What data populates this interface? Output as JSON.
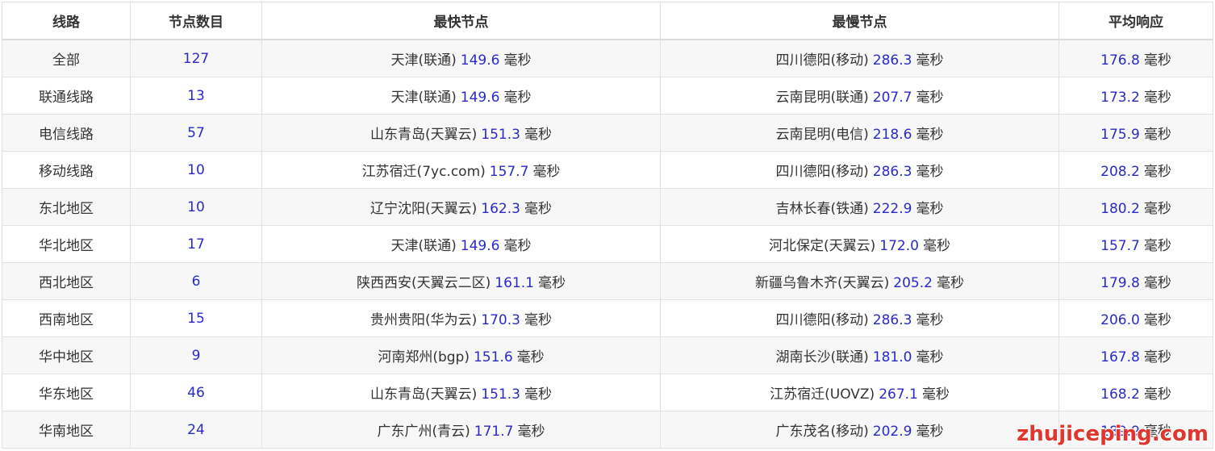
{
  "headers": {
    "line": "线路",
    "count": "节点数目",
    "fastest": "最快节点",
    "slowest": "最慢节点",
    "average": "平均响应"
  },
  "unit": "毫秒",
  "rows": [
    {
      "line": "全部",
      "count": "127",
      "fast_node": "天津(联通)",
      "fast_ms": "149.6",
      "slow_node": "四川德阳(移动)",
      "slow_ms": "286.3",
      "avg_ms": "176.8"
    },
    {
      "line": "联通线路",
      "count": "13",
      "fast_node": "天津(联通)",
      "fast_ms": "149.6",
      "slow_node": "云南昆明(联通)",
      "slow_ms": "207.7",
      "avg_ms": "173.2"
    },
    {
      "line": "电信线路",
      "count": "57",
      "fast_node": "山东青岛(天翼云)",
      "fast_ms": "151.3",
      "slow_node": "云南昆明(电信)",
      "slow_ms": "218.6",
      "avg_ms": "175.9"
    },
    {
      "line": "移动线路",
      "count": "10",
      "fast_node": "江苏宿迁(7yc.com)",
      "fast_ms": "157.7",
      "slow_node": "四川德阳(移动)",
      "slow_ms": "286.3",
      "avg_ms": "208.2"
    },
    {
      "line": "东北地区",
      "count": "10",
      "fast_node": "辽宁沈阳(天翼云)",
      "fast_ms": "162.3",
      "slow_node": "吉林长春(铁通)",
      "slow_ms": "222.9",
      "avg_ms": "180.2"
    },
    {
      "line": "华北地区",
      "count": "17",
      "fast_node": "天津(联通)",
      "fast_ms": "149.6",
      "slow_node": "河北保定(天翼云)",
      "slow_ms": "172.0",
      "avg_ms": "157.7"
    },
    {
      "line": "西北地区",
      "count": "6",
      "fast_node": "陕西西安(天翼云二区)",
      "fast_ms": "161.1",
      "slow_node": "新疆乌鲁木齐(天翼云)",
      "slow_ms": "205.2",
      "avg_ms": "179.8"
    },
    {
      "line": "西南地区",
      "count": "15",
      "fast_node": "贵州贵阳(华为云)",
      "fast_ms": "170.3",
      "slow_node": "四川德阳(移动)",
      "slow_ms": "286.3",
      "avg_ms": "206.0"
    },
    {
      "line": "华中地区",
      "count": "9",
      "fast_node": "河南郑州(bgp)",
      "fast_ms": "151.6",
      "slow_node": "湖南长沙(联通)",
      "slow_ms": "181.0",
      "avg_ms": "167.8"
    },
    {
      "line": "华东地区",
      "count": "46",
      "fast_node": "山东青岛(天翼云)",
      "fast_ms": "151.3",
      "slow_node": "江苏宿迁(UOVZ)",
      "slow_ms": "267.1",
      "avg_ms": "168.2"
    },
    {
      "line": "华南地区",
      "count": "24",
      "fast_node": "广东广州(青云)",
      "fast_ms": "171.7",
      "slow_node": "广东茂名(移动)",
      "slow_ms": "202.9",
      "avg_ms": "189.9"
    }
  ],
  "watermark": "zhujiceping.com",
  "colors": {
    "number": "#2a2acc",
    "text": "#333333",
    "stripe": "#f7f7f7",
    "border": "#e2e2e2",
    "watermark": "#e2352e"
  }
}
